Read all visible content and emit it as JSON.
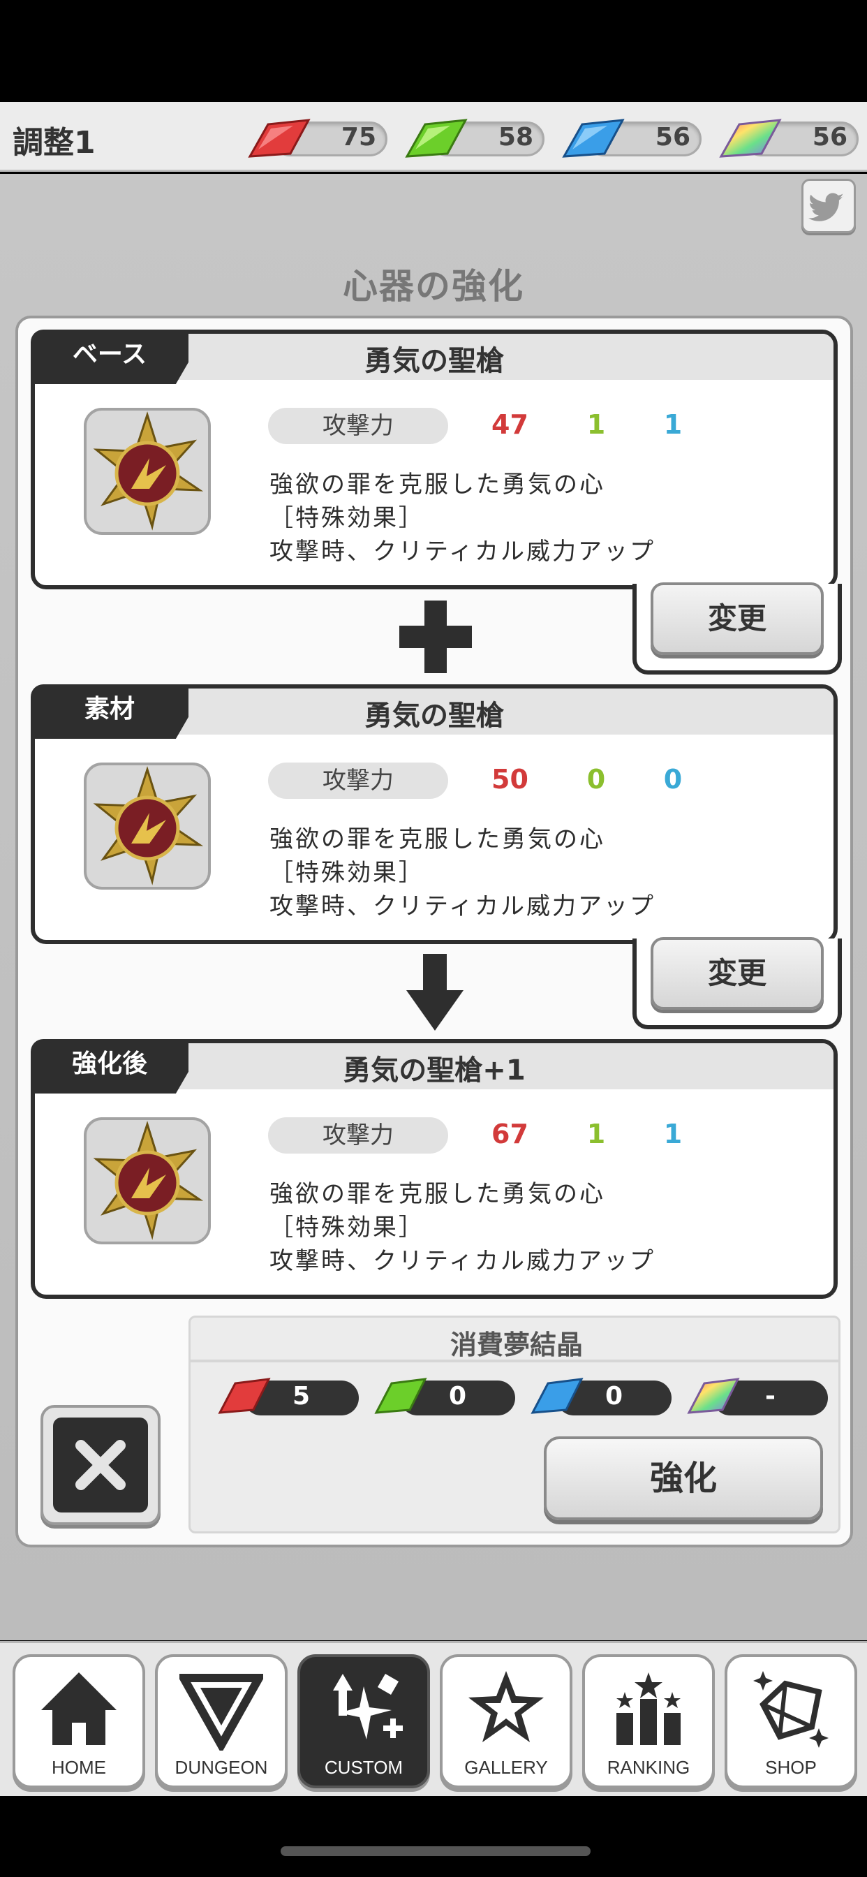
{
  "topbar": {
    "title": "調整1",
    "gems": [
      {
        "color": "red",
        "hex": "#e23c3c",
        "value": "75"
      },
      {
        "color": "green",
        "hex": "#6ccf2a",
        "value": "58"
      },
      {
        "color": "blue",
        "hex": "#3a9ee8",
        "value": "56"
      },
      {
        "color": "rainbow",
        "hex": "#c47ae0",
        "value": "56"
      }
    ]
  },
  "share": {
    "icon": "twitter-icon"
  },
  "screen": {
    "title": "心器の強化"
  },
  "base": {
    "tag": "ベース",
    "name": "勇気の聖槍",
    "stat_label": "攻撃力",
    "red": "47",
    "green": "1",
    "blue": "1",
    "desc1": "強欲の罪を克服した勇気の心",
    "desc2": "［特殊効果］",
    "desc3": "攻撃時、クリティカル威力アップ",
    "change_label": "変更"
  },
  "material": {
    "tag": "素材",
    "name": "勇気の聖槍",
    "stat_label": "攻撃力",
    "red": "50",
    "green": "0",
    "blue": "0",
    "desc1": "強欲の罪を克服した勇気の心",
    "desc2": "［特殊効果］",
    "desc3": "攻撃時、クリティカル威力アップ",
    "change_label": "変更"
  },
  "result": {
    "tag": "強化後",
    "name": "勇気の聖槍+1",
    "stat_label": "攻撃力",
    "red": "67",
    "green": "1",
    "blue": "1",
    "desc1": "強欲の罪を克服した勇気の心",
    "desc2": "［特殊効果］",
    "desc3": "攻撃時、クリティカル威力アップ"
  },
  "cost": {
    "title": "消費夢結晶",
    "items": [
      {
        "color": "red",
        "value": "5"
      },
      {
        "color": "green",
        "value": "0"
      },
      {
        "color": "blue",
        "value": "0"
      },
      {
        "color": "rainbow",
        "value": "-"
      }
    ],
    "enhance_label": "強化"
  },
  "close": {
    "icon": "close-icon"
  },
  "nav": [
    {
      "label": "HOME",
      "icon": "home-icon",
      "active": false
    },
    {
      "label": "DUNGEON",
      "icon": "dungeon-icon",
      "active": false
    },
    {
      "label": "CUSTOM",
      "icon": "custom-icon",
      "active": true
    },
    {
      "label": "GALLERY",
      "icon": "gallery-icon",
      "active": false
    },
    {
      "label": "RANKING",
      "icon": "ranking-icon",
      "active": false
    },
    {
      "label": "SHOP",
      "icon": "shop-icon",
      "active": false
    }
  ]
}
